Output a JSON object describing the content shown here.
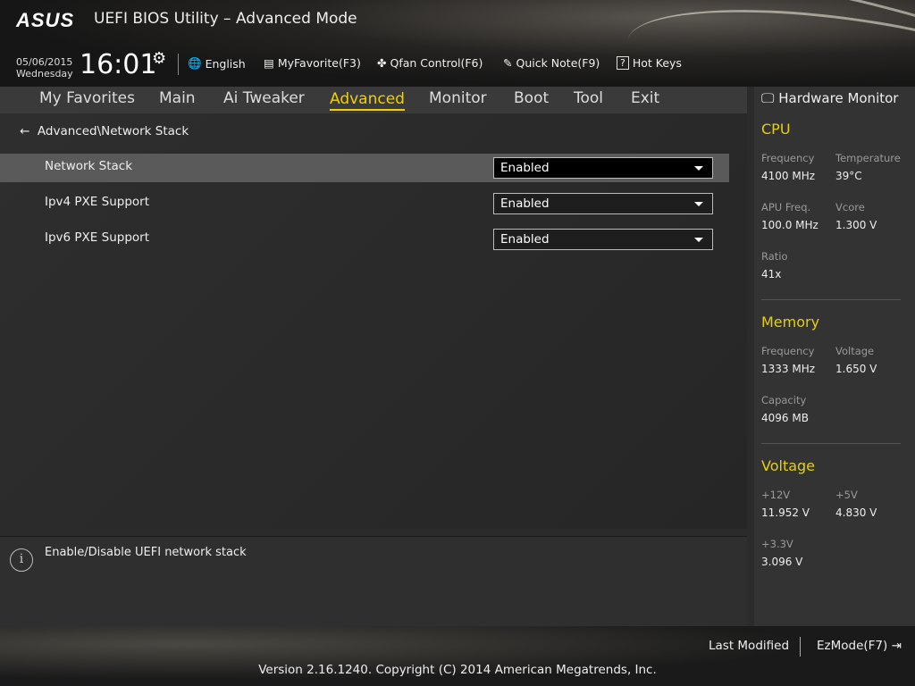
{
  "header": {
    "logo": "ASUS",
    "title": "UEFI BIOS Utility – Advanced Mode",
    "date": "05/06/2015",
    "day": "Wednesday",
    "time": "16:01",
    "toolbar": [
      {
        "icon": "globe-icon",
        "glyph": "🌐",
        "label": "English"
      },
      {
        "icon": "favorite-list-icon",
        "glyph": "▤",
        "label": "MyFavorite(F3)"
      },
      {
        "icon": "fan-icon",
        "glyph": "✤",
        "label": "Qfan Control(F6)"
      },
      {
        "icon": "note-icon",
        "glyph": "✎",
        "label": "Quick Note(F9)"
      },
      {
        "icon": "help-icon",
        "glyph": "?",
        "label": "Hot Keys"
      }
    ]
  },
  "nav": [
    "My Favorites",
    "Main",
    "Ai Tweaker",
    "Advanced",
    "Monitor",
    "Boot",
    "Tool",
    "Exit"
  ],
  "active_tab": "Advanced",
  "breadcrumb": "Advanced\\Network Stack",
  "settings": [
    {
      "label": "Network Stack",
      "value": "Enabled"
    },
    {
      "label": "Ipv4 PXE Support",
      "value": "Enabled"
    },
    {
      "label": "Ipv6 PXE Support",
      "value": "Enabled"
    }
  ],
  "help_text": "Enable/Disable UEFI network stack",
  "hw": {
    "title": "Hardware Monitor",
    "cpu": {
      "title": "CPU",
      "freq_k": "Frequency",
      "freq": "4100 MHz",
      "temp_k": "Temperature",
      "temp": "39°C",
      "apu_k": "APU Freq.",
      "apu": "100.0 MHz",
      "vcore_k": "Vcore",
      "vcore": "1.300 V",
      "ratio_k": "Ratio",
      "ratio": "41x"
    },
    "mem": {
      "title": "Memory",
      "freq_k": "Frequency",
      "freq": "1333 MHz",
      "volt_k": "Voltage",
      "volt": "1.650 V",
      "cap_k": "Capacity",
      "cap": "4096 MB"
    },
    "volt": {
      "title": "Voltage",
      "v12_k": "+12V",
      "v12": "11.952 V",
      "v5_k": "+5V",
      "v5": "4.830 V",
      "v33_k": "+3.3V",
      "v33": "3.096 V"
    }
  },
  "footer": {
    "last_modified": "Last Modified",
    "ezmode": "EzMode(F7)",
    "version": "Version 2.16.1240. Copyright (C) 2014 American Megatrends, Inc."
  },
  "colors": {
    "accent": "#f0d000"
  }
}
